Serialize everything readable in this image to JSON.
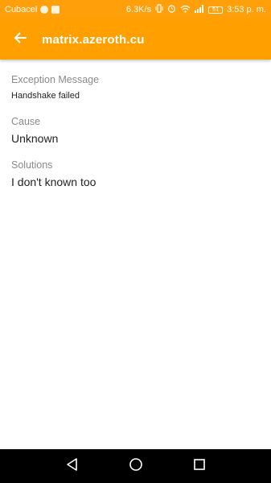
{
  "status_bar": {
    "carrier": "Cubacel",
    "net_speed": "6.3K/s",
    "battery": "51",
    "time": "3:53 p. m."
  },
  "app_bar": {
    "title": "matrix.azeroth.cu",
    "back_icon": "arrow-back-icon"
  },
  "sections": [
    {
      "label": "Exception Message",
      "value": "Handshake failed"
    },
    {
      "label": "Cause",
      "value": "Unknown"
    },
    {
      "label": "Solutions",
      "value": "I don't known too"
    }
  ],
  "nav_bar": {
    "back_icon": "triangle-back-icon",
    "home_icon": "circle-home-icon",
    "recents_icon": "square-recents-icon"
  },
  "colors": {
    "app_bar": "#ffa000",
    "status_bar": "#ff9f0a",
    "label_gray": "#8a8a8a",
    "text_dark": "#222222"
  }
}
